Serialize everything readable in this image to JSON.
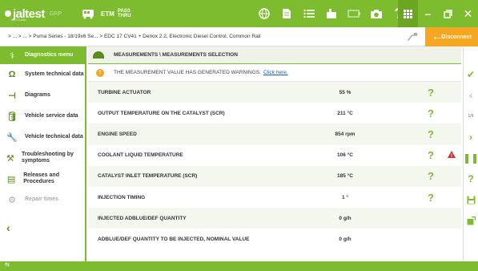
{
  "topbar": {
    "brand": "jaltest",
    "brand_sub": "by COJALI",
    "grp": "GRP",
    "etm": "ETM",
    "pass_line1": "PASS",
    "pass_line2": "THRU",
    "accent": "#7dbb2f"
  },
  "breadcrumb": {
    "text": "> ... > ... > Puma Series - 18/19x6 Se... > EDC 17 CV41 + Denox 2.2, Electronic Diesel Control, Common Rail"
  },
  "disconnect_label": "Disconnect",
  "sidebar": {
    "items": [
      {
        "label": "Diagnostics menu",
        "icon": "diagnostics-icon"
      },
      {
        "label": "System technical data",
        "icon": "ohm-icon"
      },
      {
        "label": "Diagrams",
        "icon": "diagram-icon"
      },
      {
        "label": "Vehicle service data",
        "icon": "oil-can-icon"
      },
      {
        "label": "Vehicle technical data",
        "icon": "wrench-icon"
      },
      {
        "label": "Troubleshooting by symptoms",
        "icon": "troubleshooting-icon"
      },
      {
        "label": "Releases and Procedures",
        "icon": "procedures-icon"
      },
      {
        "label": "Repair times",
        "icon": "gear-icon"
      }
    ]
  },
  "main": {
    "header": "MEASUREMENTS \\ MEASUREMENTS SELECTION",
    "warning_text": "THE MEASUREMENT VALUE HAS GENERATED WARNINGS.",
    "warning_link": "Click here.",
    "rows": [
      {
        "name": "TURBINE ACTUATOR",
        "value": "55 %",
        "help": "?",
        "alarm": ""
      },
      {
        "name": "OUTPUT TEMPERATURE ON THE CATALYST (SCR)",
        "value": "211 °C",
        "help": "?",
        "alarm": ""
      },
      {
        "name": "ENGINE SPEED",
        "value": "854 rpm",
        "help": "?",
        "alarm": ""
      },
      {
        "name": "COOLANT LIQUID TEMPERATURE",
        "value": "106 °C",
        "help": "?",
        "alarm": "!"
      },
      {
        "name": "CATALYST INLET TEMPERATURE (SCR)",
        "value": "185 °C",
        "help": "?",
        "alarm": ""
      },
      {
        "name": "INJECTION TIMING",
        "value": "1 °",
        "help": "?",
        "alarm": ""
      },
      {
        "name": "INJECTED ADBLUE/DEF QUANTITY",
        "value": "0 g/h",
        "help": "",
        "alarm": ""
      },
      {
        "name": "ADBLUE/DEF QUANTITY TO BE INJECTED, NOMINAL VALUE",
        "value": "0 g/h",
        "help": "",
        "alarm": ""
      }
    ]
  },
  "right_bar": {
    "page": "1/9"
  }
}
